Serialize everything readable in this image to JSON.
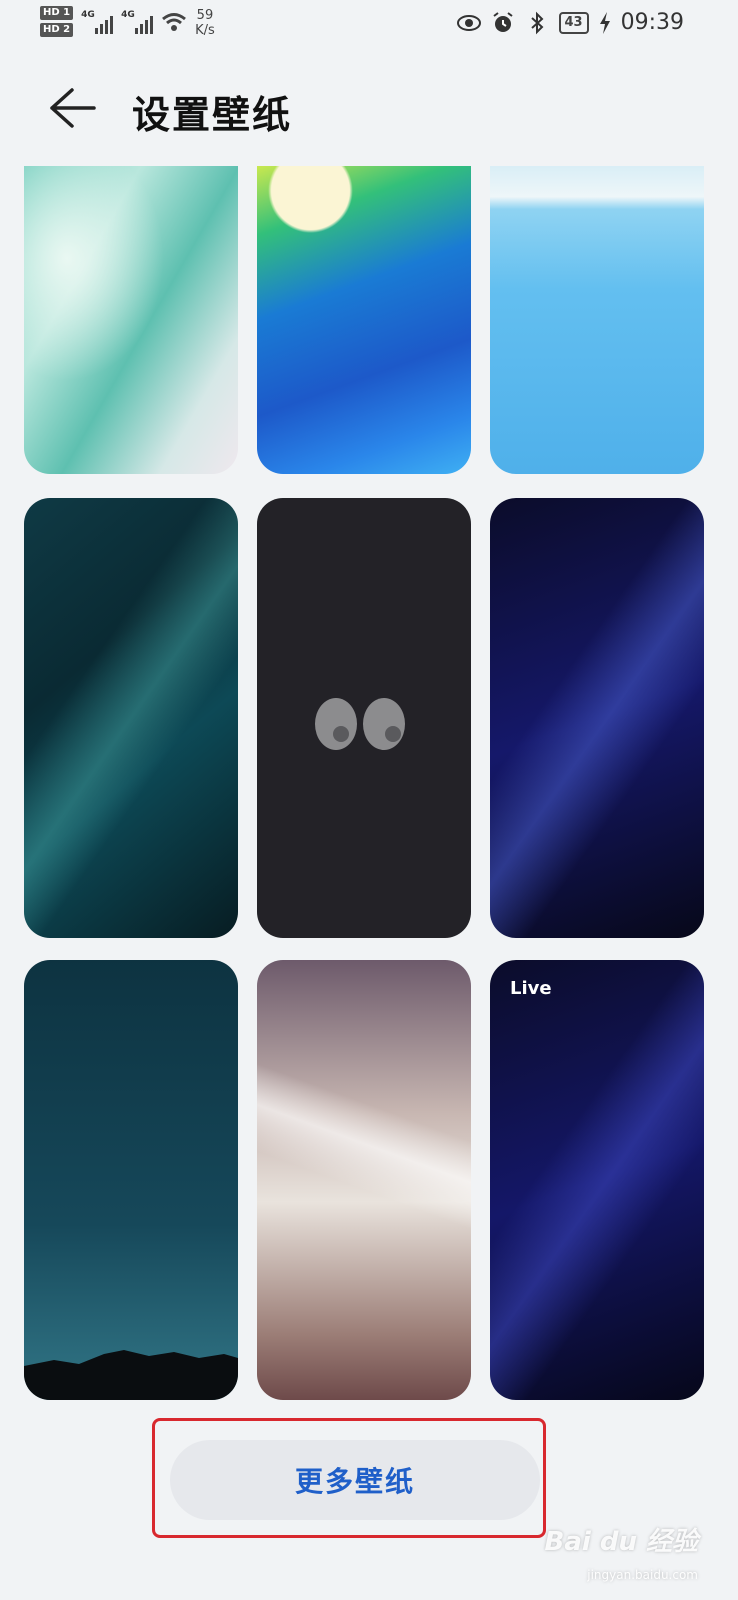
{
  "status_bar": {
    "hd1": "HD 1",
    "hd2": "HD 2",
    "sim1_label": "4G",
    "sim2_label": "4G",
    "speed_value": "59",
    "speed_unit": "K/s",
    "battery": "43",
    "time": "09:39",
    "icons": [
      "eye-comfort-icon",
      "alarm-icon",
      "bluetooth-icon",
      "charging-icon"
    ]
  },
  "header": {
    "title": "设置壁纸",
    "back_icon": "arrow-left-icon"
  },
  "wallpapers": [
    {
      "id": "marble-teal",
      "label": ""
    },
    {
      "id": "blue-flow",
      "label": ""
    },
    {
      "id": "lake-blue",
      "label": ""
    },
    {
      "id": "teal-streaks",
      "label": ""
    },
    {
      "id": "dark-eyes",
      "label": ""
    },
    {
      "id": "indigo-streaks",
      "label": ""
    },
    {
      "id": "mountain-dusk",
      "label": ""
    },
    {
      "id": "pastel-wave",
      "label": ""
    },
    {
      "id": "indigo-live",
      "label": "Live"
    }
  ],
  "more_button": {
    "label": "更多壁纸"
  },
  "watermark": {
    "main": "Bai du 经验",
    "sub": "jingyan.baidu.com"
  },
  "colors": {
    "accent": "#1f5fc9",
    "highlight_border": "#d8282e",
    "background": "#f1f3f5"
  }
}
